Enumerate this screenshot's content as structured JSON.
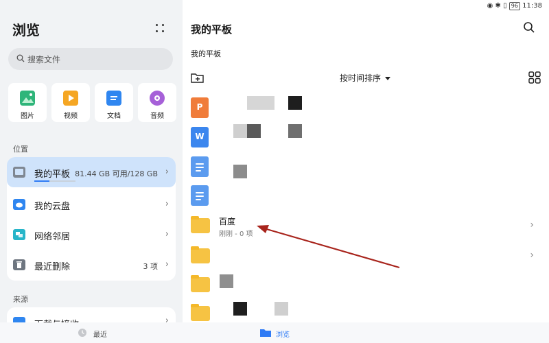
{
  "status_bar": {
    "battery": "96",
    "time": "11:38"
  },
  "sidebar": {
    "title": "浏览",
    "search_placeholder": "搜索文件",
    "categories": [
      {
        "label": "图片",
        "icon": "image-icon",
        "color": "#2fb57a"
      },
      {
        "label": "视频",
        "icon": "video-icon",
        "color": "#f5a623"
      },
      {
        "label": "文档",
        "icon": "document-icon",
        "color": "#2f86f0"
      },
      {
        "label": "音频",
        "icon": "audio-icon",
        "color": "#a660d8"
      }
    ],
    "location_header": "位置",
    "locations": [
      {
        "label": "我的平板",
        "detail": "81.44 GB 可用/128 GB",
        "icon": "tablet-icon",
        "selected": true,
        "used_fraction": 0.36
      },
      {
        "label": "我的云盘",
        "detail": "",
        "icon": "cloud-icon"
      },
      {
        "label": "网络邻居",
        "detail": "",
        "icon": "network-icon"
      },
      {
        "label": "最近删除",
        "detail": "3 项",
        "icon": "trash-icon"
      }
    ],
    "source_header": "来源",
    "source_partial": "下载与接收"
  },
  "main": {
    "title": "我的平板",
    "breadcrumb": "我的平板",
    "sort_label": "按时间排序",
    "files": [
      {
        "type": "ppt",
        "letter": "P",
        "name": "",
        "meta": ""
      },
      {
        "type": "word",
        "letter": "W",
        "name": "",
        "meta": ""
      },
      {
        "type": "doc",
        "letter": "",
        "name": "",
        "meta": ""
      },
      {
        "type": "doc",
        "letter": "",
        "name": "",
        "meta": ""
      },
      {
        "type": "folder",
        "name": "百度",
        "meta": "刚刚 - 0 项"
      },
      {
        "type": "folder",
        "name": "",
        "meta": ""
      },
      {
        "type": "folder",
        "name": "",
        "meta": ""
      },
      {
        "type": "folder",
        "name": "",
        "meta": ""
      }
    ]
  },
  "tabbar": {
    "recent": "最近",
    "browse": "浏览"
  },
  "colors": {
    "accent": "#2f7bf5",
    "annotation_arrow": "#a8241c",
    "folder": "#f6c343"
  }
}
